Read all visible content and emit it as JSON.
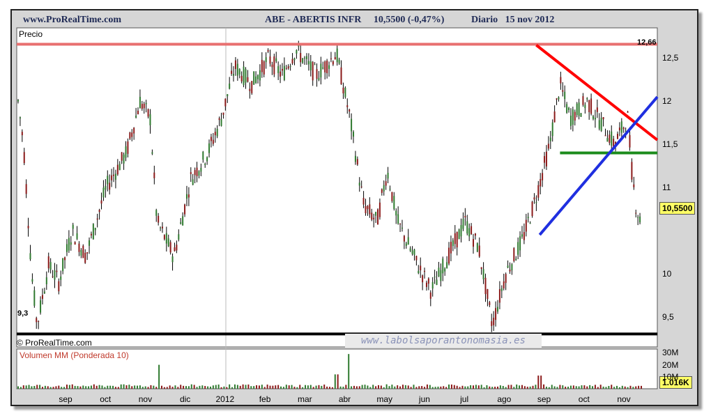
{
  "header": {
    "site": "www.ProRealTime.com",
    "title": "ABE - ABERTIS INFR",
    "price_change": "10,5500 (-0,47%)",
    "period": "Diario",
    "date": "15 nov 2012"
  },
  "panels": {
    "price_label": "Precio",
    "volume_label": "Volumen MM (Ponderada 10)",
    "copyright": "© ProRealTime.com",
    "watermark": "www.labolsaporantonomasia.es"
  },
  "colors": {
    "resistance": "#e87070",
    "support": "#000000",
    "downtrend": "#ff0000",
    "uptrend": "#1f2fe0",
    "horizontal": "#1c8c1c",
    "candle_up": "#2f7a2f",
    "candle_down": "#8b1a1a",
    "badge": "#ffff66"
  },
  "chart_data": {
    "type": "candlestick",
    "y_axis": {
      "min": 9.15,
      "max": 12.85,
      "ticks": [
        {
          "v": 9.5,
          "label": "9,5"
        },
        {
          "v": 10,
          "label": "10"
        },
        {
          "v": 11,
          "label": "11"
        },
        {
          "v": 11.5,
          "label": "11,5"
        },
        {
          "v": 12,
          "label": "12"
        },
        {
          "v": 12.5,
          "label": "12,5"
        }
      ]
    },
    "x_axis": {
      "labels": [
        "sep",
        "oct",
        "nov",
        "dic",
        "2012",
        "feb",
        "mar",
        "abr",
        "may",
        "jun",
        "jul",
        "ago",
        "sep",
        "oct",
        "nov"
      ]
    },
    "last_value": "10,5500",
    "levels": [
      {
        "name": "resistance",
        "value": 12.66,
        "label": "12,66"
      },
      {
        "name": "support",
        "value": 9.3,
        "label": "9,3"
      },
      {
        "name": "horizontal",
        "value": 11.4
      }
    ],
    "trendlines": [
      {
        "name": "downtrend",
        "from": 12.65,
        "to": 11.55
      },
      {
        "name": "uptrend",
        "from": 10.45,
        "to": 12.05
      }
    ],
    "price_path": [
      {
        "t": 0,
        "v": 12.0
      },
      {
        "t": 8,
        "v": 11.5
      },
      {
        "t": 20,
        "v": 10.0
      },
      {
        "t": 28,
        "v": 9.4
      },
      {
        "t": 45,
        "v": 10.1
      },
      {
        "t": 60,
        "v": 9.9
      },
      {
        "t": 80,
        "v": 10.5
      },
      {
        "t": 100,
        "v": 10.2
      },
      {
        "t": 130,
        "v": 11.0
      },
      {
        "t": 160,
        "v": 11.4
      },
      {
        "t": 180,
        "v": 12.0
      },
      {
        "t": 195,
        "v": 11.8
      },
      {
        "t": 205,
        "v": 10.6
      },
      {
        "t": 230,
        "v": 10.2
      },
      {
        "t": 255,
        "v": 11.1
      },
      {
        "t": 280,
        "v": 11.4
      },
      {
        "t": 300,
        "v": 11.8
      },
      {
        "t": 320,
        "v": 12.4
      },
      {
        "t": 345,
        "v": 12.2
      },
      {
        "t": 370,
        "v": 12.5
      },
      {
        "t": 390,
        "v": 12.3
      },
      {
        "t": 410,
        "v": 12.6
      },
      {
        "t": 440,
        "v": 12.3
      },
      {
        "t": 470,
        "v": 12.55
      },
      {
        "t": 490,
        "v": 11.8
      },
      {
        "t": 510,
        "v": 10.8
      },
      {
        "t": 530,
        "v": 10.6
      },
      {
        "t": 545,
        "v": 11.2
      },
      {
        "t": 560,
        "v": 10.6
      },
      {
        "t": 590,
        "v": 10.1
      },
      {
        "t": 610,
        "v": 9.8
      },
      {
        "t": 635,
        "v": 10.2
      },
      {
        "t": 660,
        "v": 10.6
      },
      {
        "t": 680,
        "v": 10.3
      },
      {
        "t": 700,
        "v": 9.4
      },
      {
        "t": 720,
        "v": 10.0
      },
      {
        "t": 745,
        "v": 10.4
      },
      {
        "t": 765,
        "v": 10.9
      },
      {
        "t": 785,
        "v": 11.5
      },
      {
        "t": 800,
        "v": 12.2
      },
      {
        "t": 815,
        "v": 11.8
      },
      {
        "t": 840,
        "v": 12.0
      },
      {
        "t": 865,
        "v": 11.7
      },
      {
        "t": 880,
        "v": 11.5
      },
      {
        "t": 900,
        "v": 11.8
      },
      {
        "t": 906,
        "v": 11.2
      },
      {
        "t": 912,
        "v": 10.8
      },
      {
        "t": 920,
        "v": 10.55
      }
    ],
    "volume": {
      "ticks": [
        {
          "v": 30,
          "label": "30M"
        },
        {
          "v": 20,
          "label": "20M"
        },
        {
          "v": 10,
          "label": "10M"
        }
      ],
      "last_label": "1.016K",
      "spikes": [
        {
          "t": 207,
          "v": 20
        },
        {
          "t": 487,
          "v": 29
        },
        {
          "t": 470,
          "v": 12
        },
        {
          "t": 770,
          "v": 11
        }
      ]
    }
  }
}
